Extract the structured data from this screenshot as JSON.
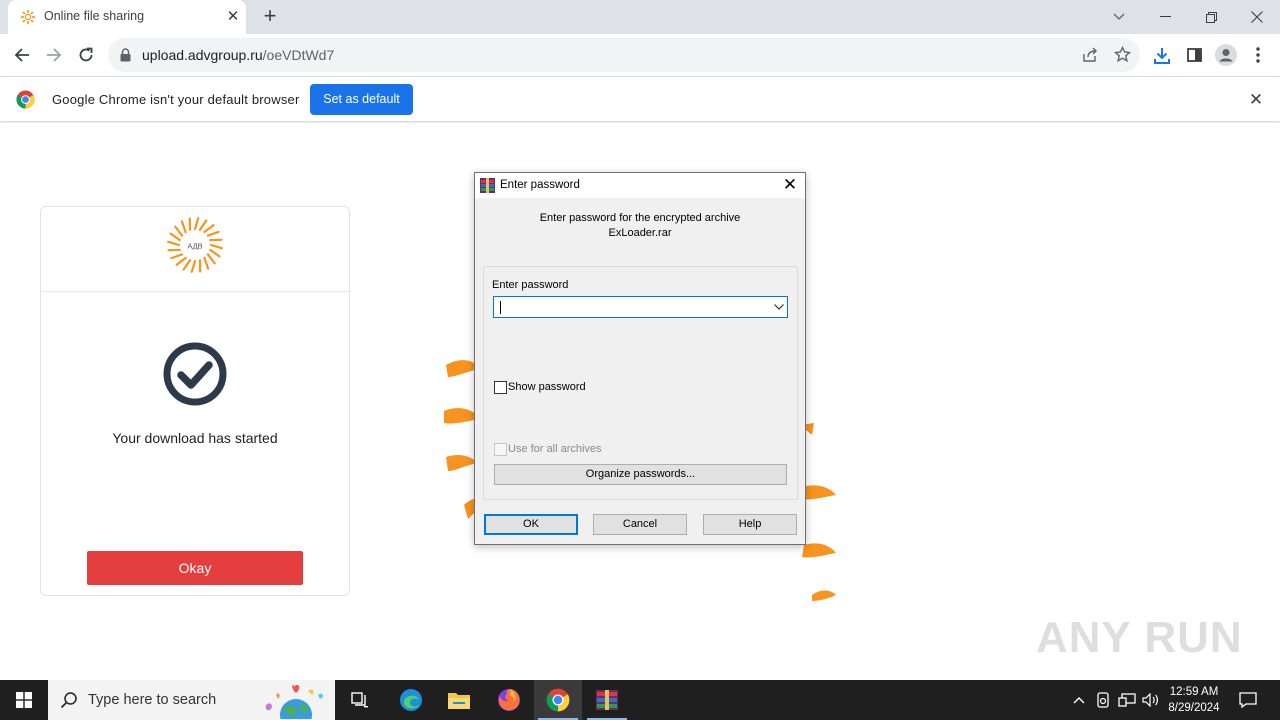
{
  "browser": {
    "tab": {
      "title": "Online file sharing"
    },
    "url": {
      "host": "upload.advgroup.ru",
      "path": "/oeVDtWd7"
    },
    "infobar": {
      "message": "Google Chrome isn't your default browser",
      "button": "Set as default"
    }
  },
  "page": {
    "brand_text": "АДВ",
    "message": "Your download has started",
    "okay_button": "Okay",
    "watermark": "ANY RUN"
  },
  "dialog": {
    "title": "Enter password",
    "message_line1": "Enter password for the encrypted archive",
    "message_line2": "ExLoader.rar",
    "password_label": "Enter password",
    "password_value": "",
    "show_password": {
      "label": "Show password",
      "checked": false
    },
    "use_for_all": {
      "label": "Use for all archives",
      "checked": false,
      "enabled": false
    },
    "organize_button": "Organize passwords...",
    "ok_button": "OK",
    "cancel_button": "Cancel",
    "help_button": "Help"
  },
  "taskbar": {
    "search_placeholder": "Type here to search",
    "time": "12:59 AM",
    "date": "8/29/2024"
  },
  "colors": {
    "accent_blue": "#1a73e8",
    "okay_red": "#e53e3e",
    "brand_orange": "#f7931e",
    "taskbar": "#1f1f1f"
  }
}
